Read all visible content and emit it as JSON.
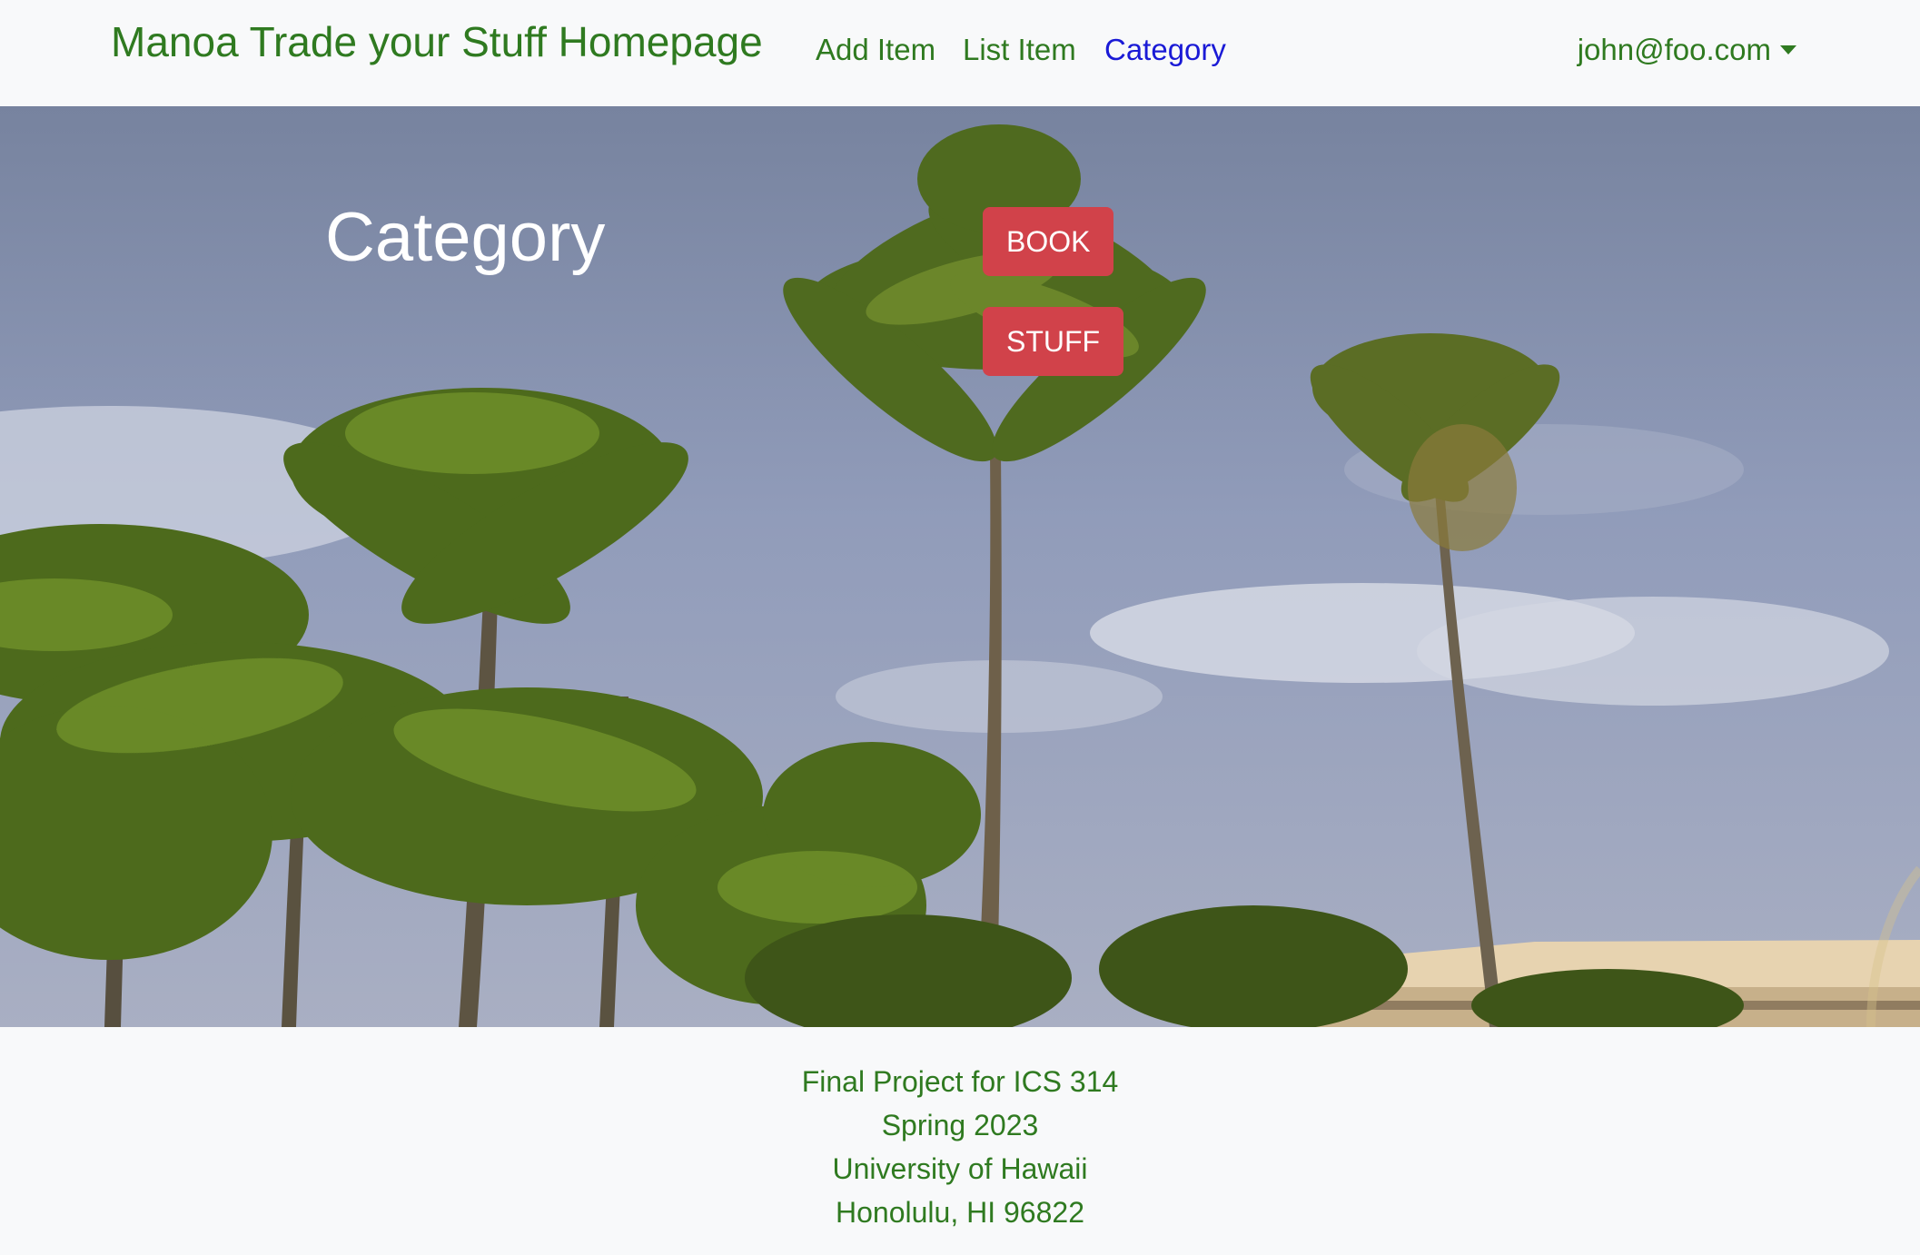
{
  "navbar": {
    "brand": "Manoa Trade your Stuff Homepage",
    "links": [
      {
        "label": "Add Item",
        "active": false
      },
      {
        "label": "List Item",
        "active": false
      },
      {
        "label": "Category",
        "active": true
      }
    ],
    "user": "john@foo.com",
    "user_icon": "caret-down-icon"
  },
  "main": {
    "title": "Category",
    "buttons": [
      "BOOK",
      "STUFF"
    ],
    "background": "palm-trees-photo"
  },
  "footer": {
    "lines": [
      "Final Project for ICS 314",
      "Spring 2023",
      "University of Hawaii",
      "Honolulu, HI 96822"
    ]
  },
  "colors": {
    "brand_green": "#2f7a20",
    "active_link": "#1a1ad6",
    "button_red": "#d1424a",
    "page_background": "#f8f9fa"
  }
}
